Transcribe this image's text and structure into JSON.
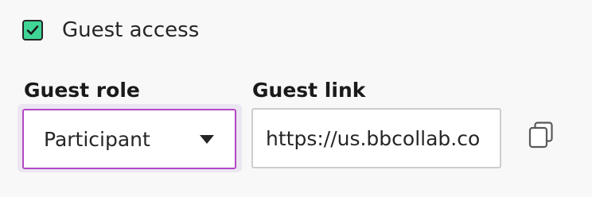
{
  "guest_access": {
    "label": "Guest access",
    "checked": true,
    "checkbox_color": "#3fd596"
  },
  "guest_role": {
    "label": "Guest role",
    "selected_value": "Participant",
    "focus_border_color": "#b248c4"
  },
  "guest_link": {
    "label": "Guest link",
    "value": "https://us.bbcollab.co"
  },
  "copy_button": {
    "icon": "copy-icon"
  }
}
